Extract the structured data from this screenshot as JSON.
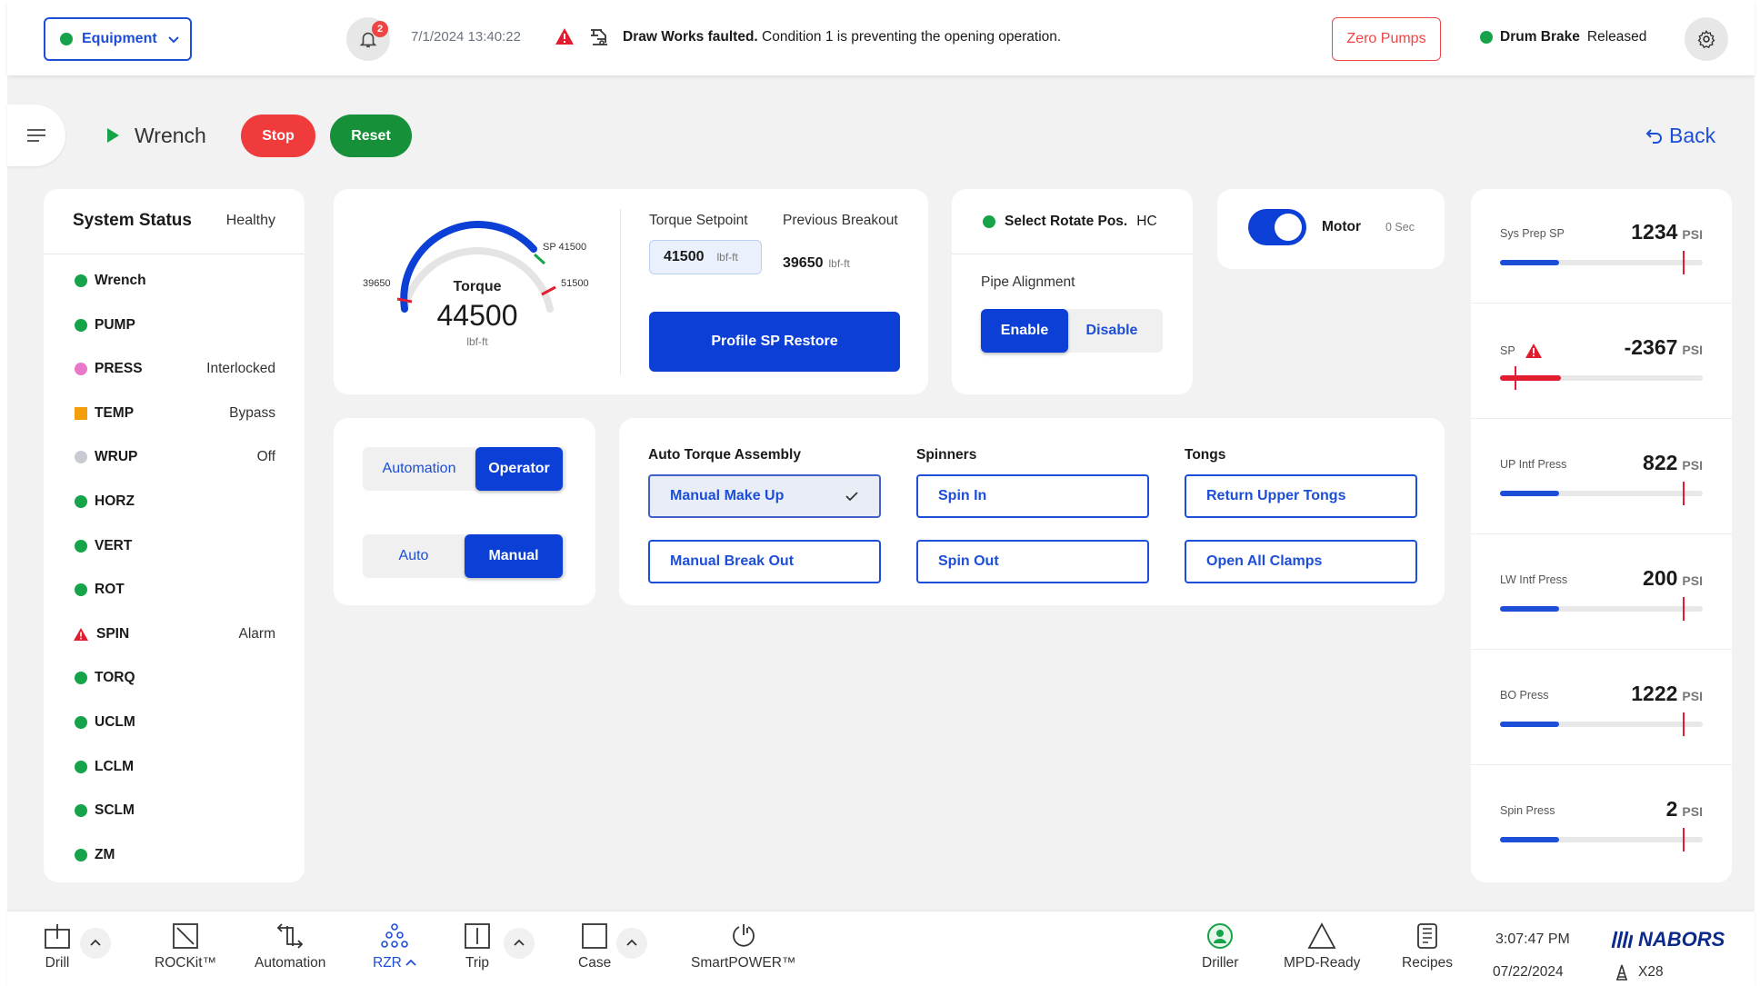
{
  "topbar": {
    "equipment_label": "Equipment",
    "notification_count": "2",
    "datetime": "7/1/2024  13:40:22",
    "fault_title": "Draw Works faulted.",
    "fault_detail": " Condition 1 is preventing the opening operation.",
    "zero_pumps_label": "Zero Pumps",
    "drum_brake_label": "Drum Brake",
    "drum_brake_state": "Released"
  },
  "header": {
    "title": "Wrench",
    "stop_label": "Stop",
    "reset_label": "Reset",
    "back_label": "Back"
  },
  "system_status": {
    "title": "System Status",
    "health": "Healthy",
    "items": [
      {
        "name": "Wrench",
        "status": "",
        "indicator": "green"
      },
      {
        "name": "PUMP",
        "status": "",
        "indicator": "green"
      },
      {
        "name": "PRESS",
        "status": "Interlocked",
        "indicator": "pink"
      },
      {
        "name": "TEMP",
        "status": "Bypass",
        "indicator": "orange-square"
      },
      {
        "name": "WRUP",
        "status": "Off",
        "indicator": "grey"
      },
      {
        "name": "HORZ",
        "status": "",
        "indicator": "green"
      },
      {
        "name": "VERT",
        "status": "",
        "indicator": "green"
      },
      {
        "name": "ROT",
        "status": "",
        "indicator": "green"
      },
      {
        "name": "SPIN",
        "status": "Alarm",
        "indicator": "alarm-triangle"
      },
      {
        "name": "TORQ",
        "status": "",
        "indicator": "green"
      },
      {
        "name": "UCLM",
        "status": "",
        "indicator": "green"
      },
      {
        "name": "LCLM",
        "status": "",
        "indicator": "green"
      },
      {
        "name": "SCLM",
        "status": "",
        "indicator": "green"
      },
      {
        "name": "ZM",
        "status": "",
        "indicator": "green"
      }
    ]
  },
  "torque": {
    "gauge_label": "Torque",
    "value": "44500",
    "unit": "lbf-ft",
    "min_label": "39650",
    "sp_label": "SP 41500",
    "max_label": "51500",
    "setpoint_label": "Torque Setpoint",
    "setpoint_value": "41500",
    "setpoint_unit": "lbf-ft",
    "prev_breakout_label": "Previous Breakout",
    "prev_breakout_value": "39650",
    "prev_breakout_unit": "lbf-ft",
    "profile_restore_label": "Profile SP Restore"
  },
  "rotate": {
    "select_label": "Select Rotate Pos.",
    "select_value": "HC",
    "pipe_alignment_label": "Pipe Alignment",
    "enable_label": "Enable",
    "disable_label": "Disable"
  },
  "motor": {
    "label": "Motor",
    "time": "0 Sec"
  },
  "mode": {
    "automation_label": "Automation",
    "operator_label": "Operator",
    "auto_label": "Auto",
    "manual_label": "Manual"
  },
  "operations": {
    "auto_torque_title": "Auto Torque Assembly",
    "spinners_title": "Spinners",
    "tongs_title": "Tongs",
    "manual_make_up": "Manual Make Up",
    "manual_break_out": "Manual Break Out",
    "spin_in": "Spin In",
    "spin_out": "Spin Out",
    "return_upper_tongs": "Return Upper Tongs",
    "open_all_clamps": "Open All Clamps"
  },
  "pressures": [
    {
      "name": "Sys Prep SP",
      "value": "1234",
      "unit": "PSI",
      "fill_fraction": 0.29,
      "marker_fraction": 0.9,
      "alarm": false
    },
    {
      "name": "SP",
      "value": "-2367",
      "unit": "PSI",
      "fill_fraction": 0.3,
      "marker_fraction": 0.07,
      "alarm": true
    },
    {
      "name": "UP Intf Press",
      "value": "822",
      "unit": "PSI",
      "fill_fraction": 0.29,
      "marker_fraction": 0.9,
      "alarm": false
    },
    {
      "name": "LW Intf Press",
      "value": "200",
      "unit": "PSI",
      "fill_fraction": 0.29,
      "marker_fraction": 0.9,
      "alarm": false
    },
    {
      "name": "BO Press",
      "value": "1222",
      "unit": "PSI",
      "fill_fraction": 0.29,
      "marker_fraction": 0.9,
      "alarm": false
    },
    {
      "name": "Spin Press",
      "value": "2",
      "unit": "PSI",
      "fill_fraction": 0.29,
      "marker_fraction": 0.9,
      "alarm": false
    }
  ],
  "bottombar": {
    "drill": "Drill",
    "rockit": "ROCKit™",
    "automation": "Automation",
    "rzr": "RZR",
    "trip": "Trip",
    "case": "Case",
    "smartpower": "SmartPOWER™",
    "driller": "Driller",
    "mpd_ready": "MPD-Ready",
    "recipes": "Recipes",
    "time": "3:07:47 PM",
    "date": "07/22/2024",
    "brand": "NABORS",
    "rig": "X28"
  },
  "colors": {
    "primary": "#0b3fd6",
    "accent_blue": "#1d4ed8",
    "ok_green": "#16a34a",
    "alarm_red": "#ef4444"
  }
}
